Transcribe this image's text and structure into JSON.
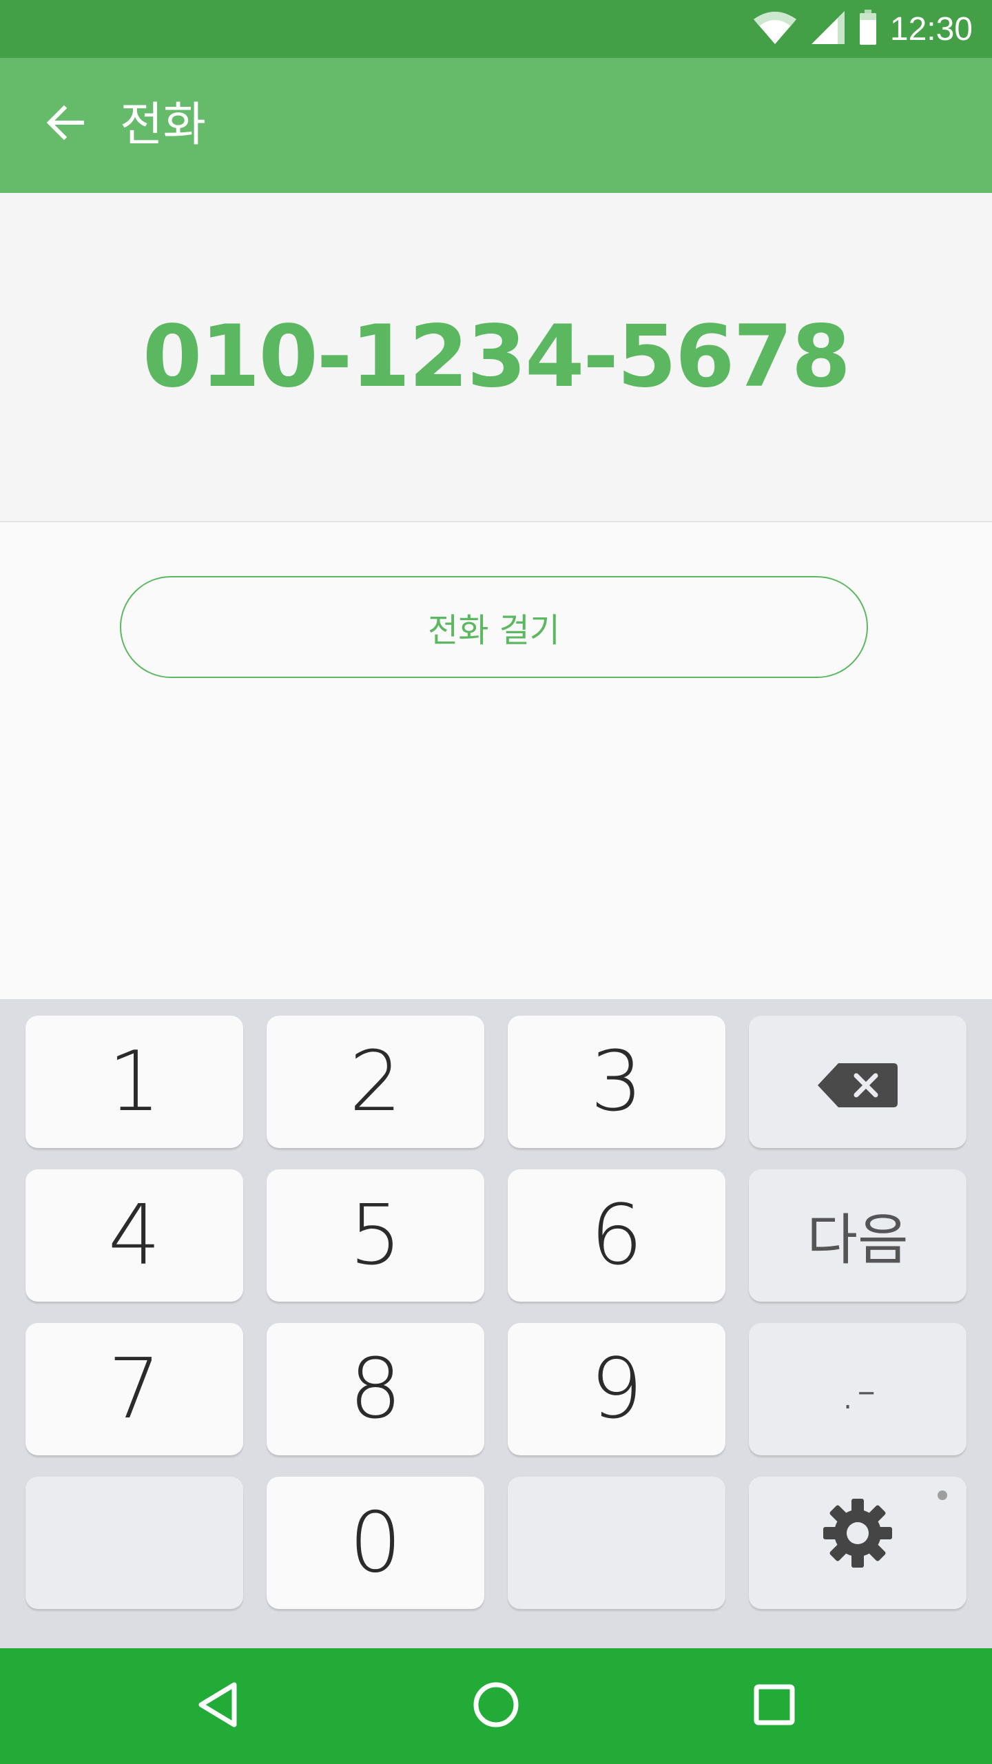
{
  "status_bar": {
    "time": "12:30",
    "icons": [
      "wifi-icon",
      "cellular-signal-icon",
      "battery-icon"
    ]
  },
  "app_bar": {
    "back_icon": "arrow-back-icon",
    "title": "전화"
  },
  "display": {
    "phone_number": "010-1234-5678"
  },
  "actions": {
    "call_label": "전화 걸기"
  },
  "keyboard": {
    "keys": {
      "k1": "1",
      "k2": "2",
      "k3": "3",
      "k4": "4",
      "k5": "5",
      "k6": "6",
      "k7": "7",
      "k8": "8",
      "k9": "9",
      "k0": "0",
      "next": "다음",
      "punct": ".-"
    },
    "backspace_icon": "backspace-icon",
    "settings_icon": "gear-icon"
  },
  "nav_bar": {
    "icons": [
      "back-triangle-icon",
      "home-circle-icon",
      "recents-square-icon"
    ]
  },
  "colors": {
    "status_bar": "#43a047",
    "app_bar": "#66bb6a",
    "accent": "#5cb860",
    "nav_bar": "#22ab37",
    "keyboard_bg": "#dcdde2"
  }
}
